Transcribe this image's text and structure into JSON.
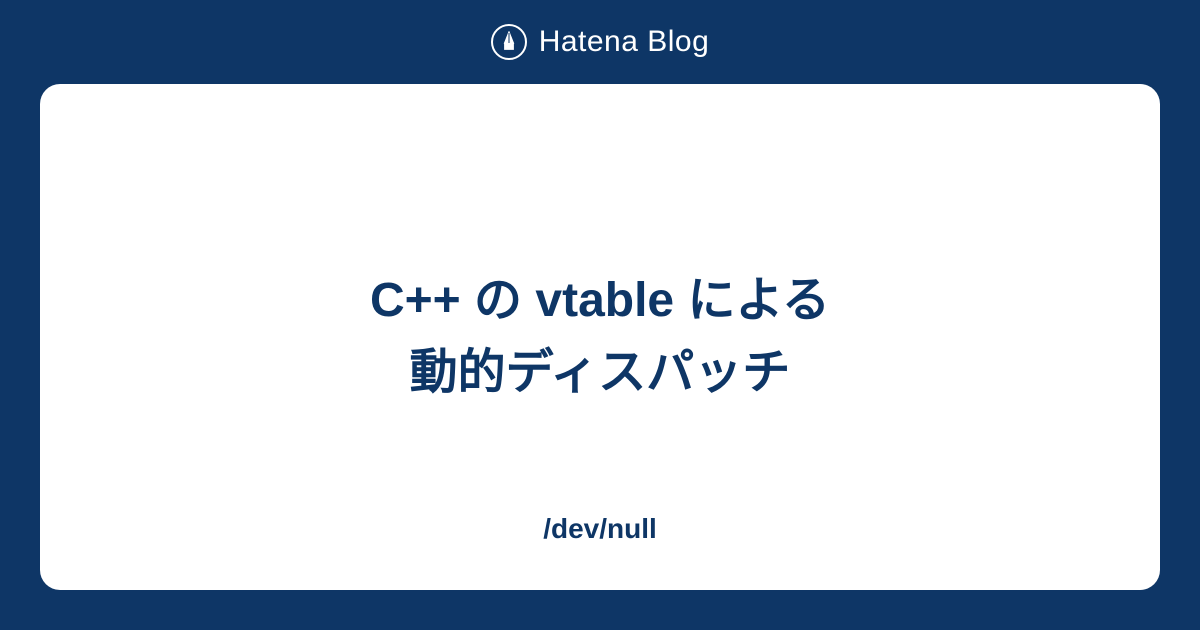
{
  "header": {
    "service_name": "Hatena Blog"
  },
  "card": {
    "article_title": "C++ の vtable による\n動的ディスパッチ",
    "blog_name": "/dev/null"
  },
  "colors": {
    "background": "#0e3666",
    "card_background": "#ffffff",
    "text_primary": "#0e3666",
    "header_text": "#ffffff"
  }
}
